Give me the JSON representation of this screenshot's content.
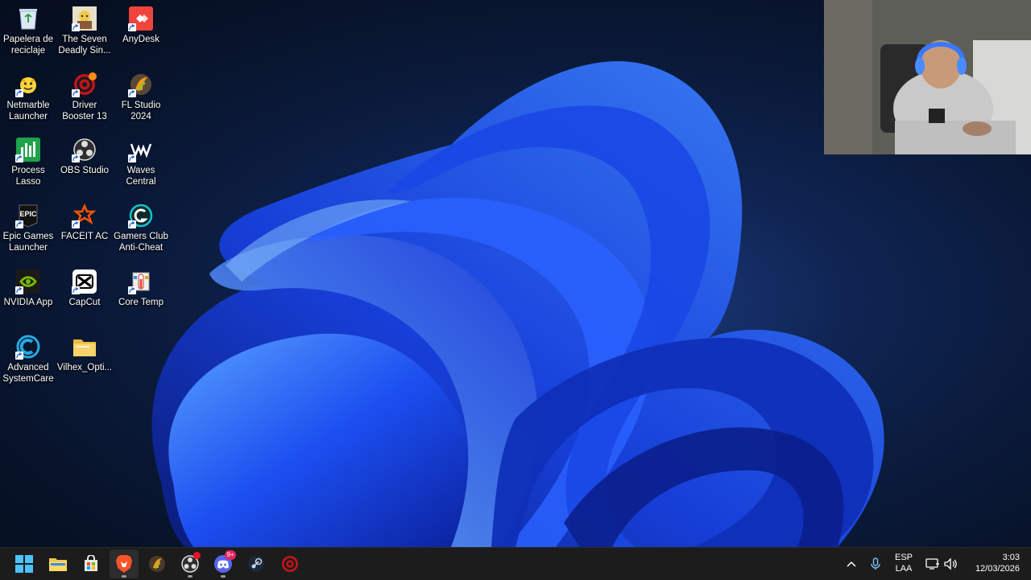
{
  "desktop_icons": [
    {
      "name": "Papelera de reciclaje",
      "label": "Papelera de\nreciclaje",
      "icon": "recycle-bin-icon"
    },
    {
      "name": "The Seven Deadly Sins",
      "label": "The Seven\nDeadly Sin...",
      "icon": "seven-deadly-sins-icon"
    },
    {
      "name": "AnyDesk",
      "label": "AnyDesk",
      "icon": "anydesk-icon"
    },
    {
      "name": "Netmarble Launcher",
      "label": "Netmarble\nLauncher",
      "icon": "netmarble-icon"
    },
    {
      "name": "Driver Booster 13",
      "label": "Driver\nBooster 13",
      "icon": "driver-booster-icon"
    },
    {
      "name": "FL Studio 2024",
      "label": "FL Studio\n2024",
      "icon": "fl-studio-icon"
    },
    {
      "name": "Process Lasso",
      "label": "Process\nLasso",
      "icon": "process-lasso-icon"
    },
    {
      "name": "OBS Studio",
      "label": "OBS Studio",
      "icon": "obs-icon"
    },
    {
      "name": "Waves Central",
      "label": "Waves\nCentral",
      "icon": "waves-icon"
    },
    {
      "name": "Epic Games Launcher",
      "label": "Epic Games\nLauncher",
      "icon": "epic-games-icon"
    },
    {
      "name": "FACEIT AC",
      "label": "FACEIT AC",
      "icon": "faceit-icon"
    },
    {
      "name": "Gamers Club Anti-Cheat",
      "label": "Gamers Club\nAnti-Cheat",
      "icon": "gamers-club-icon"
    },
    {
      "name": "NVIDIA App",
      "label": "NVIDIA App",
      "icon": "nvidia-icon"
    },
    {
      "name": "CapCut",
      "label": "CapCut",
      "icon": "capcut-icon"
    },
    {
      "name": "Core Temp",
      "label": "Core Temp",
      "icon": "core-temp-icon"
    },
    {
      "name": "Advanced SystemCare",
      "label": "Advanced\nSystemCare",
      "icon": "advanced-systemcare-icon"
    },
    {
      "name": "Vilhex_Opti",
      "label": "Vilhex_Opti...",
      "icon": "folder-icon"
    }
  ],
  "taskbar": {
    "apps": [
      {
        "name": "start",
        "icon": "windows-start-icon",
        "active": false
      },
      {
        "name": "file-explorer",
        "icon": "folder-icon",
        "active": false
      },
      {
        "name": "microsoft-store",
        "icon": "store-icon",
        "active": false
      },
      {
        "name": "brave",
        "icon": "brave-icon",
        "active": true
      },
      {
        "name": "fl-studio",
        "icon": "fl-studio-icon",
        "active": false
      },
      {
        "name": "obs-studio",
        "icon": "obs-icon",
        "active": false,
        "badge_dot": true
      },
      {
        "name": "discord",
        "icon": "discord-icon",
        "active": false,
        "badge": "9+"
      },
      {
        "name": "steam",
        "icon": "steam-icon",
        "active": false
      },
      {
        "name": "driver-booster",
        "icon": "driver-booster-icon",
        "active": false
      }
    ],
    "tray": {
      "language_line1": "ESP",
      "language_line2": "LAA",
      "time": "3:03",
      "date": "12/03/2026"
    }
  },
  "colors": {
    "accent_blue": "#2f6bff",
    "taskbar_bg": "#1c1c1c",
    "desktop_bg": "#0a1a3a"
  }
}
